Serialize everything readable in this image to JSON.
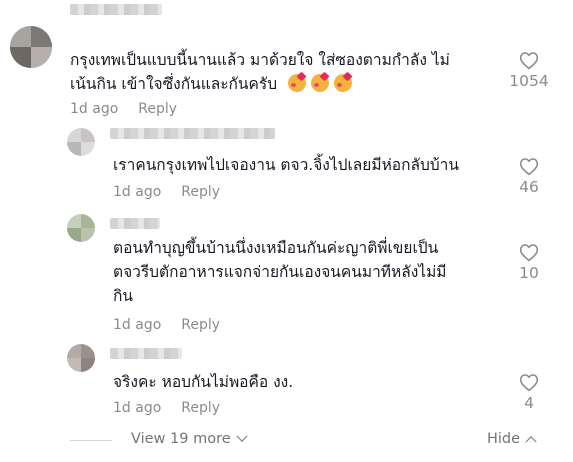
{
  "comments": [
    {
      "lines": [
        "กรุงเทพเป็นแบบนี้นานแล้ว มาด้วยใจ ใส่ซองตามกำลัง ไม่",
        "เน้นกิน เข้าใจซึ่งกันและกันครับ"
      ],
      "emoji_count": 3,
      "emoji_icon": "smiling-face-with-hearts-icon",
      "time": "1d ago",
      "reply": "Reply",
      "likes": "1054"
    },
    {
      "lines": [
        "เราคนกรุงเทพไปเจองาน ตจว.จิ้งไปเลยมีห่อกลับบ้าน"
      ],
      "time": "1d ago",
      "reply": "Reply",
      "likes": "46"
    },
    {
      "lines": [
        "ตอนทำบุญขึ้นบ้านนึ่งงเหมือนกันค่ะญาติพี่เขยเป็น",
        "ตจวรีบตักอาหารแจกจ่ายกันเองจนคนมาทีหลังไม่มี",
        "กิน"
      ],
      "time": "1d ago",
      "reply": "Reply",
      "likes": "10"
    },
    {
      "lines": [
        "จริงคะ หอบกันไม่พอคือ งง."
      ],
      "time": "1d ago",
      "reply": "Reply",
      "likes": "4"
    }
  ],
  "footer": {
    "view_more": "View 19 more",
    "hide": "Hide"
  },
  "colors": {
    "text": "#161823",
    "muted": "#8a8b91"
  }
}
